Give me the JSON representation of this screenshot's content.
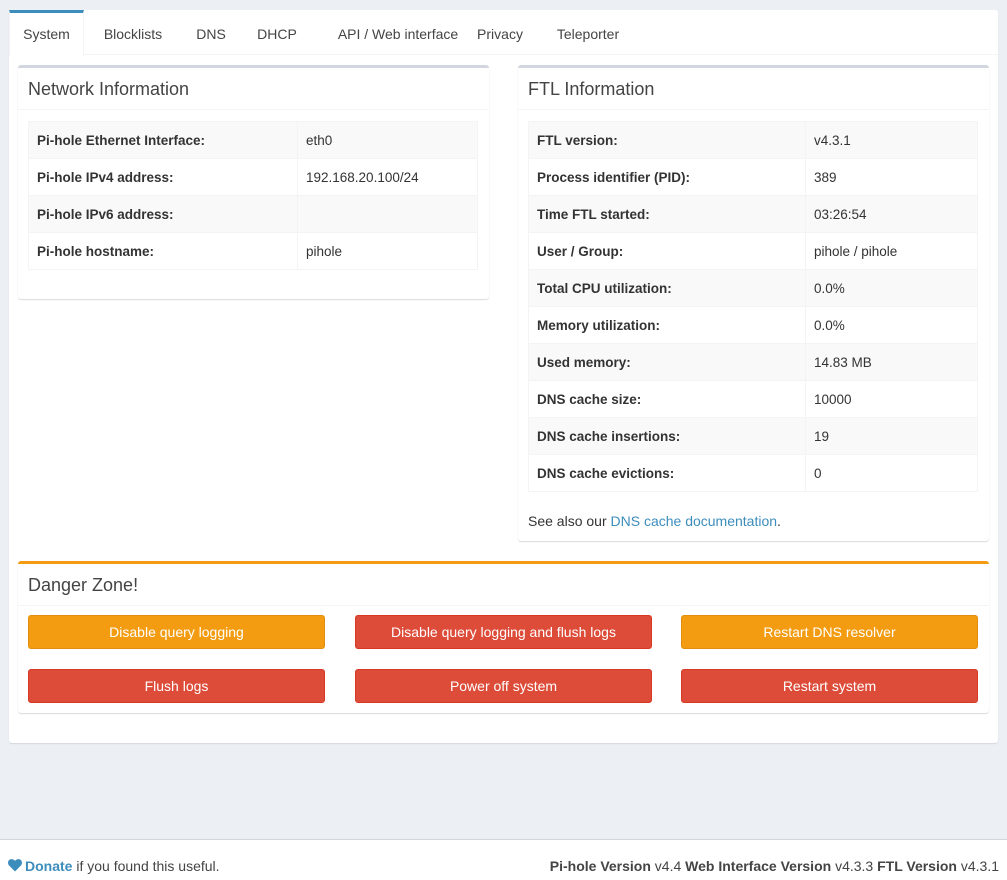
{
  "tabs": [
    "System",
    "Blocklists",
    "DNS",
    "DHCP",
    "API / Web interface",
    "Privacy",
    "Teleporter"
  ],
  "network": {
    "title": "Network Information",
    "rows": [
      {
        "k": "Pi-hole Ethernet Interface:",
        "v": "eth0"
      },
      {
        "k": "Pi-hole IPv4 address:",
        "v": "192.168.20.100/24"
      },
      {
        "k": "Pi-hole IPv6 address:",
        "v": ""
      },
      {
        "k": "Pi-hole hostname:",
        "v": "pihole"
      }
    ]
  },
  "ftl": {
    "title": "FTL Information",
    "rows": [
      {
        "k": "FTL version:",
        "v": "v4.3.1"
      },
      {
        "k": "Process identifier (PID):",
        "v": "389"
      },
      {
        "k": "Time FTL started:",
        "v": "03:26:54"
      },
      {
        "k": "User / Group:",
        "v": "pihole / pihole"
      },
      {
        "k": "Total CPU utilization:",
        "v": "0.0%"
      },
      {
        "k": "Memory utilization:",
        "v": "0.0%"
      },
      {
        "k": "Used memory:",
        "v": "14.83 MB"
      },
      {
        "k": "DNS cache size:",
        "v": "10000"
      },
      {
        "k": "DNS cache insertions:",
        "v": "19"
      },
      {
        "k": "DNS cache evictions:",
        "v": "0"
      }
    ],
    "see_also_prefix": "See also our",
    "see_also_link": "DNS cache documentation",
    "see_also_suffix": "."
  },
  "danger": {
    "title": "Danger Zone!",
    "buttons": {
      "disable_logging": "Disable query logging",
      "disable_flush": "Disable query logging and flush logs",
      "restart_dns": "Restart DNS resolver",
      "flush_logs": "Flush logs",
      "power_off": "Power off system",
      "restart_system": "Restart system"
    }
  },
  "footer": {
    "donate": "Donate",
    "donate_suffix": "if you found this useful.",
    "pihole_label": "Pi-hole Version",
    "pihole_ver": "v4.4",
    "web_label": "Web Interface Version",
    "web_ver": "v4.3.3",
    "ftl_label": "FTL Version",
    "ftl_ver": "v4.3.1"
  },
  "colors": {
    "primary": "#3c8dbc",
    "warning": "#f39c12",
    "danger": "#dd4b39"
  }
}
